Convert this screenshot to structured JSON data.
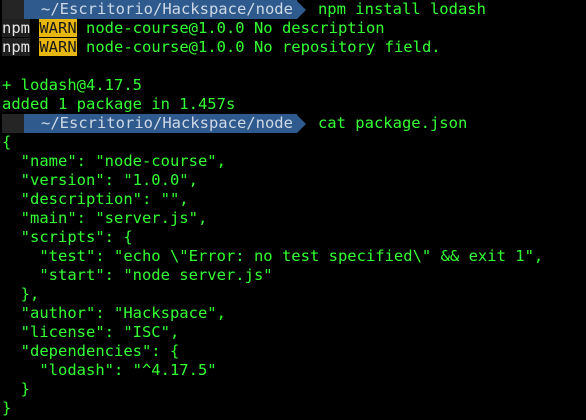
{
  "prompts": [
    {
      "path": "~/Escritorio/Hackspace/node",
      "command": "npm install lodash"
    },
    {
      "path": "~/Escritorio/Hackspace/node",
      "command": "cat package.json"
    }
  ],
  "npm_warnings": [
    {
      "label": "npm",
      "level": "WARN",
      "message": " node-course@1.0.0 No description"
    },
    {
      "label": "npm",
      "level": "WARN",
      "message": " node-course@1.0.0 No repository field."
    }
  ],
  "install_output": {
    "blank": "",
    "added_package": "+ lodash@4.17.5",
    "summary": "added 1 package in 1.457s"
  },
  "package_json_lines": [
    "{",
    "  \"name\": \"node-course\",",
    "  \"version\": \"1.0.0\",",
    "  \"description\": \"\",",
    "  \"main\": \"server.js\",",
    "  \"scripts\": {",
    "    \"test\": \"echo \\\"Error: no test specified\\\" && exit 1\",",
    "    \"start\": \"node server.js\"",
    "  },",
    "  \"author\": \"Hackspace\",",
    "  \"license\": \"ISC\",",
    "  \"dependencies\": {",
    "    \"lodash\": \"^4.17.5\"",
    "  }",
    "}"
  ],
  "colors": {
    "background": "#000000",
    "text_green": "#33ff33",
    "prompt_path_bg": "#2f5a8d",
    "prompt_path_fg": "#cfd9e6",
    "warn_bg": "#e8b70f"
  }
}
